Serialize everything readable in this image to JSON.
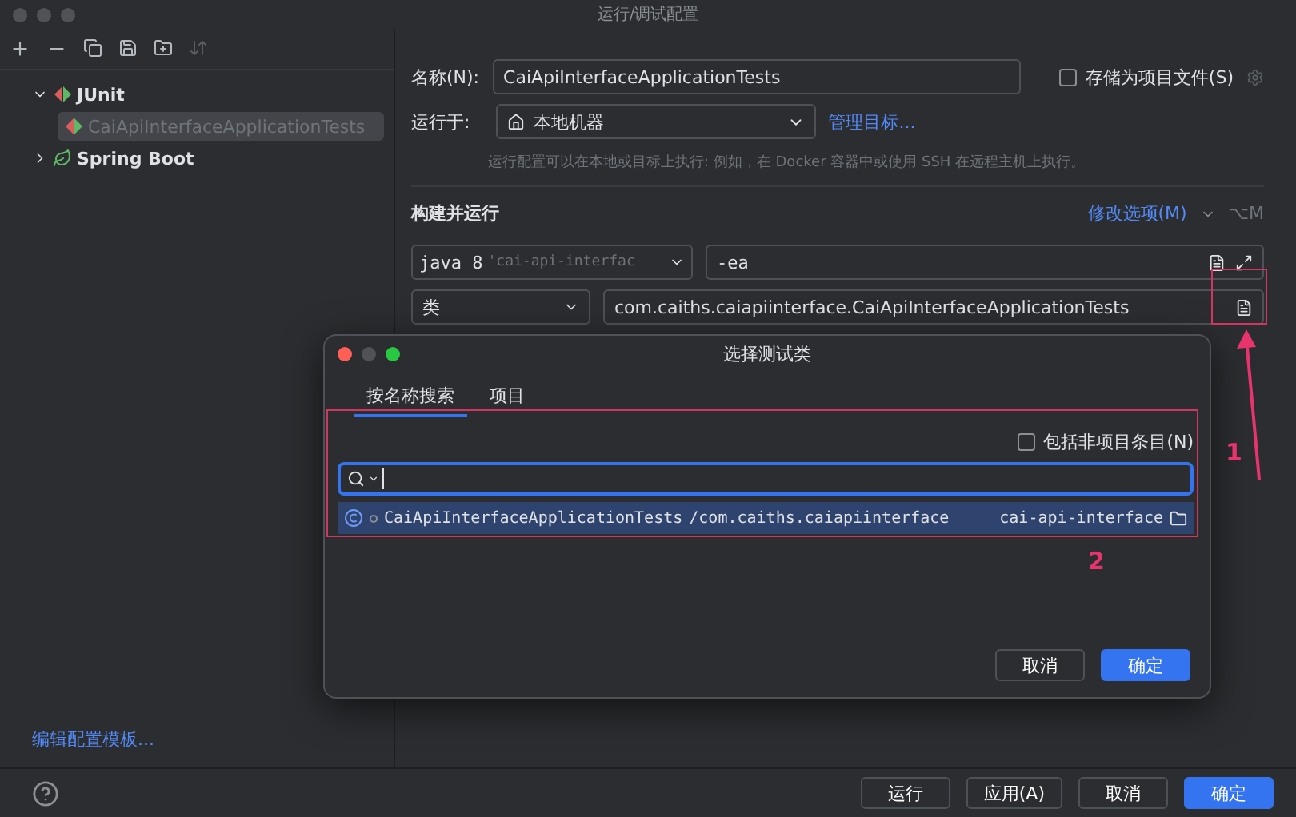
{
  "window": {
    "title": "运行/调试配置"
  },
  "sidebar": {
    "tree": [
      {
        "label": "JUnit",
        "kind": "junit",
        "expanded": true,
        "children": [
          {
            "label": "CaiApiInterfaceApplicationTests",
            "kind": "junit",
            "selected": true
          }
        ]
      },
      {
        "label": "Spring Boot",
        "kind": "spring",
        "expanded": false
      }
    ],
    "footer_link": "编辑配置模板..."
  },
  "form": {
    "name_label": "名称(N):",
    "name_value": "CaiApiInterfaceApplicationTests",
    "store_checkbox": {
      "label": "存储为项目文件(S)",
      "checked": false
    },
    "run_on": {
      "label": "运行于:",
      "value": "本地机器",
      "link": "管理目标..."
    },
    "run_on_hint": "运行配置可以在本地或目标上执行: 例如，在 Docker 容器中或使用 SSH 在远程主机上执行。",
    "section_title": "构建并运行",
    "modify_options": "修改选项(M)",
    "modify_shortcut": "⌥M",
    "jre": {
      "value": "java 8",
      "hint": "'cai-api-interfac"
    },
    "vm_options": "-ea",
    "class_kind": "类",
    "class_value": "com.caiths.caiapiinterface.CaiApiInterfaceApplicationTests"
  },
  "dialog": {
    "title": "选择测试类",
    "tabs": [
      {
        "label": "按名称搜索",
        "selected": true
      },
      {
        "label": "项目",
        "selected": false
      }
    ],
    "include_checkbox": {
      "label": "包括非项目条目(N)",
      "checked": false
    },
    "results": [
      {
        "name": "CaiApiInterfaceApplicationTests",
        "package": "/com.caiths.caiapiinterface",
        "module": "cai-api-interface",
        "selected": true
      }
    ],
    "buttons": [
      {
        "label": "取消",
        "primary": false
      },
      {
        "label": "确定",
        "primary": true
      }
    ]
  },
  "annotations": [
    "1",
    "2"
  ],
  "footer_buttons": [
    {
      "label": "运行",
      "primary": false
    },
    {
      "label": "应用(A)",
      "primary": false
    },
    {
      "label": "取消",
      "primary": false
    },
    {
      "label": "确定",
      "primary": true
    }
  ]
}
